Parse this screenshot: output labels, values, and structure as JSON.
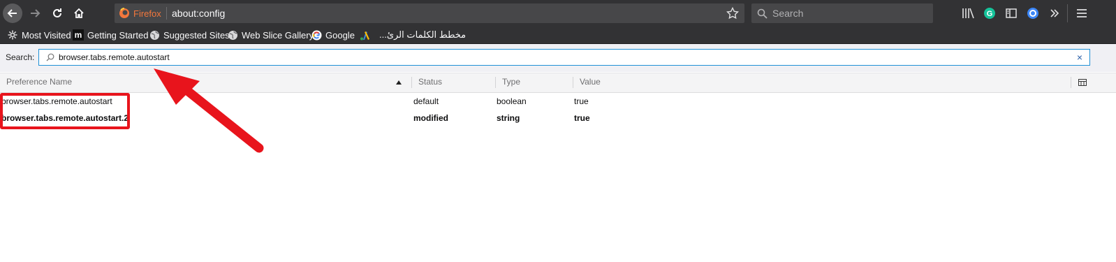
{
  "toolbar": {
    "back_icon": "back-arrow-icon",
    "forward_icon": "forward-arrow-icon",
    "reload_icon": "reload-icon",
    "home_icon": "home-icon",
    "identity_label": "Firefox",
    "url": "about:config",
    "bookmark_star_icon": "star-icon",
    "search_placeholder": "Search",
    "library_icon": "library-icon",
    "grammarly_icon": "grammarly-icon",
    "sidebar_icon": "sidebar-icon",
    "extension_icon": "extension-icon",
    "overflow_icon": "chevrons-right-icon",
    "menu_icon": "hamburger-menu-icon"
  },
  "bookmarks": [
    {
      "label": "Most Visited",
      "icon": "gear-icon"
    },
    {
      "label": "Getting Started",
      "icon": "m-logo-icon"
    },
    {
      "label": "Suggested Sites",
      "icon": "globe-icon"
    },
    {
      "label": "Web Slice Gallery",
      "icon": "globe-icon"
    },
    {
      "label": "Google",
      "icon": "google-icon"
    },
    {
      "label": "",
      "icon": "adwords-icon"
    },
    {
      "label": "مخطط الكلمات الرئ...",
      "icon": ""
    }
  ],
  "config": {
    "search_label": "Search:",
    "search_value": "browser.tabs.remote.autostart",
    "clear_icon": "×",
    "columns": [
      "Preference Name",
      "Status",
      "Type",
      "Value"
    ],
    "rows": [
      {
        "name": "browser.tabs.remote.autostart",
        "status": "default",
        "type": "boolean",
        "value": "true",
        "modified": false
      },
      {
        "name": "browser.tabs.remote.autostart.2",
        "status": "modified",
        "type": "string",
        "value": "true",
        "modified": true
      }
    ]
  },
  "colors": {
    "toolbar_bg": "#323234",
    "annotation_red": "#e8141c",
    "search_focus": "#1e90d6",
    "firefox_orange": "#f3773c"
  }
}
